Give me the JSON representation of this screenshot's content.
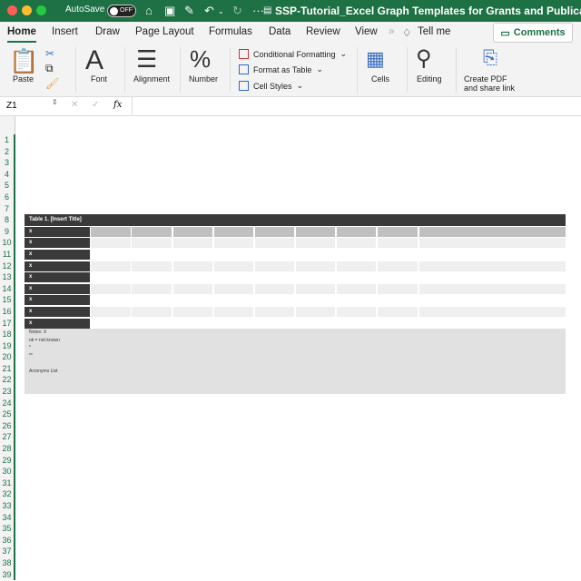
{
  "titlebar": {
    "autosave_label": "AutoSave",
    "toggle_state": "OFF",
    "title": "SSP-Tutorial_Excel Graph Templates for Grants and Publica...",
    "traffic_colors": [
      "#ff5f57",
      "#febc2e",
      "#28c840"
    ]
  },
  "tabs": [
    "Home",
    "Insert",
    "Draw",
    "Page Layout",
    "Formulas",
    "Data",
    "Review",
    "View"
  ],
  "tell_me": "Tell me",
  "comments_label": "Comments",
  "ribbon": {
    "paste": "Paste",
    "font": "Font",
    "alignment": "Alignment",
    "number": "Number",
    "conditional_formatting": "Conditional Formatting",
    "format_as_table": "Format as Table",
    "cell_styles": "Cell Styles",
    "cells": "Cells",
    "editing": "Editing",
    "create_pdf_1": "Create PDF",
    "create_pdf_2": "and share link"
  },
  "formula_bar": {
    "name_box": "Z1",
    "fx": "fx",
    "value": ""
  },
  "row_numbers": [
    1,
    2,
    3,
    4,
    5,
    6,
    7,
    8,
    9,
    10,
    11,
    12,
    13,
    14,
    15,
    16,
    17,
    18,
    19,
    20,
    21,
    22,
    23,
    24,
    25,
    26,
    27,
    28,
    29,
    30,
    31,
    32,
    33,
    34,
    35,
    36,
    37,
    38,
    39
  ],
  "table": {
    "title": "Table 1. [Insert Title]",
    "row_labels": [
      "x",
      "x",
      "x",
      "x",
      "x",
      "x",
      "x",
      "x",
      "x"
    ],
    "notes": [
      "Notes: X",
      "nk = not known",
      "*",
      "**",
      "",
      "Acronyms List"
    ]
  }
}
